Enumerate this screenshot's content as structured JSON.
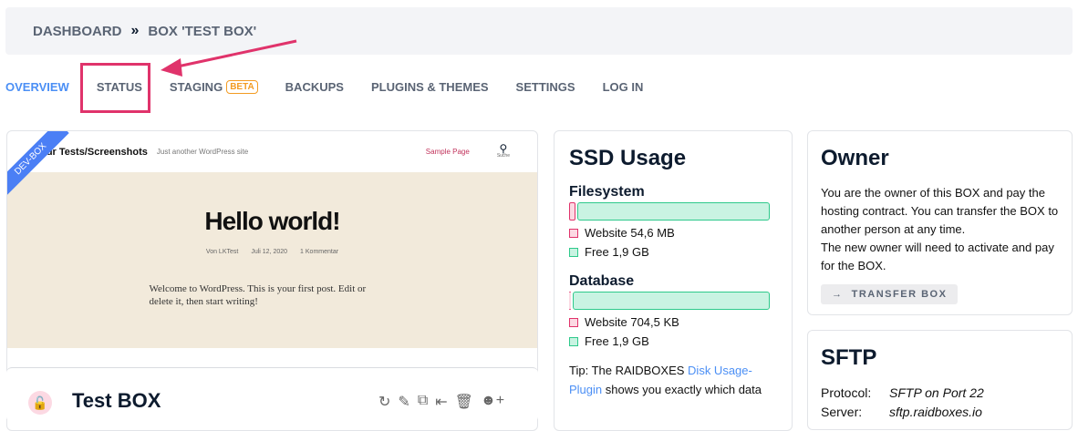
{
  "breadcrumb": {
    "home": "DASHBOARD",
    "separator": "»",
    "current": "BOX 'TEST BOX'"
  },
  "tabs": [
    {
      "label": "OVERVIEW"
    },
    {
      "label": "STATUS"
    },
    {
      "label": "STAGING",
      "badge": "BETA"
    },
    {
      "label": "BACKUPS"
    },
    {
      "label": "PLUGINS & THEMES"
    },
    {
      "label": "SETTINGS"
    },
    {
      "label": "LOG IN"
    }
  ],
  "preview": {
    "ribbon": "DEV-BOX",
    "site_title": "k für Tests/Screenshots",
    "tagline": "Just another WordPress site",
    "nav_link": "Sample Page",
    "search_label": "Suche",
    "post_title": "Hello world!",
    "author": "Von LKTest",
    "date": "Juli 12, 2020",
    "comments": "1 Kommentar",
    "excerpt": "Welcome to WordPress. This is your first post. Edit or delete it, then start writing!"
  },
  "box": {
    "title": "Test BOX"
  },
  "ssd": {
    "title": "SSD Usage",
    "filesystem": {
      "title": "Filesystem",
      "website": "Website 54,6 MB",
      "free": "Free 1,9 GB",
      "used_fraction": 0.03
    },
    "database": {
      "title": "Database",
      "website": "Website 704,5 KB",
      "free": "Free 1,9 GB",
      "used_fraction": 0.005
    },
    "tip_prefix": "Tip: The RAIDBOXES ",
    "tip_link": "Disk Usage-Plugin",
    "tip_suffix": " shows you exactly which data"
  },
  "owner": {
    "title": "Owner",
    "text1": "You are the owner of this BOX and pay the hosting contract. You can transfer the BOX to another person at any time.",
    "text2": "The new owner will need to activate and pay for the BOX.",
    "button": "TRANSFER BOX"
  },
  "sftp": {
    "title": "SFTP",
    "protocol_label": "Protocol:",
    "protocol": "SFTP on Port 22",
    "server_label": "Server:",
    "server": "sftp.raidboxes.io"
  }
}
